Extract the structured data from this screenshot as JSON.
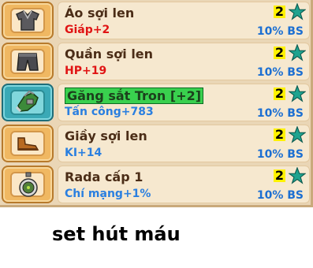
{
  "items": [
    {
      "icon": "shirt-icon",
      "name": "Áo sợi len",
      "stat": "Giáp+2",
      "stat_color": "#e01414",
      "level": "2",
      "bonus": "10% BS",
      "selected": false
    },
    {
      "icon": "pants-icon",
      "name": "Quần sợi len",
      "stat": "HP+19",
      "stat_color": "#e01414",
      "level": "2",
      "bonus": "10% BS",
      "selected": false
    },
    {
      "icon": "gloves-icon",
      "name": "Găng sắt Tron [+2]",
      "stat": "Tấn công+783",
      "stat_color": "#2a7fe0",
      "level": "2",
      "bonus": "10% BS",
      "selected": true
    },
    {
      "icon": "shoes-icon",
      "name": "Giầy sợi len",
      "stat": "KI+14",
      "stat_color": "#2a7fe0",
      "level": "2",
      "bonus": "10% BS",
      "selected": false
    },
    {
      "icon": "radar-icon",
      "name": "Rada cấp 1",
      "stat": "Chí mạng+1%",
      "stat_color": "#2a7fe0",
      "level": "2",
      "bonus": "10% BS",
      "selected": false
    }
  ],
  "caption": "set hút máu",
  "colors": {
    "bonus": "#1c6fd2",
    "level_bg": "#fff200",
    "star": "#1fa38f"
  }
}
